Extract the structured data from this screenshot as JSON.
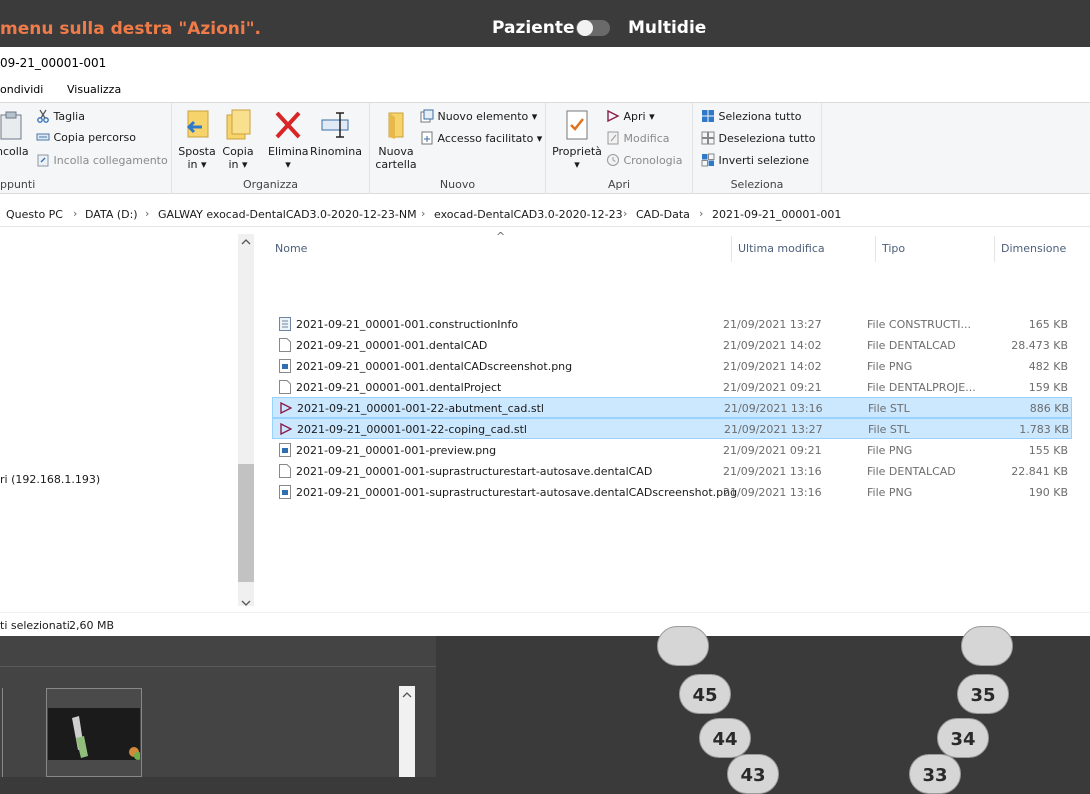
{
  "app_bar": {
    "hint": " menu sulla destra \"Azioni\".",
    "label_left": "Paziente",
    "label_right": "Multidie",
    "toggle_on": false
  },
  "window": {
    "title": "09-21_00001-001",
    "tabs": [
      "ondividi",
      "Visualizza"
    ]
  },
  "ribbon": {
    "clipboard": {
      "paste_label": "ncolla",
      "cut": "Taglia",
      "copy_path": "Copia percorso",
      "paste_link": "Incolla collegamento",
      "group": "ppunti"
    },
    "organize": {
      "move": "Sposta",
      "move_sub": "in ▾",
      "copy": "Copia",
      "copy_sub": "in ▾",
      "delete": "Elimina",
      "delete_sub": "▾",
      "rename": "Rinomina",
      "group": "Organizza"
    },
    "new": {
      "folder": "Nuova",
      "folder_sub": "cartella",
      "new_item": "Nuovo elemento ▾",
      "easy_access": "Accesso facilitato ▾",
      "group": "Nuovo"
    },
    "open": {
      "properties": "Proprietà",
      "properties_sub": "▾",
      "open": "Apri ▾",
      "edit": "Modifica",
      "history": "Cronologia",
      "group": "Apri"
    },
    "select": {
      "select_all": "Seleziona tutto",
      "deselect_all": "Deseleziona tutto",
      "invert": "Inverti selezione",
      "group": "Seleziona"
    }
  },
  "breadcrumb": [
    "Questo PC",
    "DATA (D:)",
    "GALWAY exocad-DentalCAD3.0-2020-12-23-NM",
    "exocad-DentalCAD3.0-2020-12-23",
    "CAD-Data",
    "2021-09-21_00001-001"
  ],
  "nav_pane": {
    "network_item": "ri (192.168.1.193)"
  },
  "columns": {
    "name": "Nome",
    "modified": "Ultima modifica",
    "type": "Tipo",
    "size": "Dimensione"
  },
  "files": [
    {
      "name": "2021-09-21_00001-001.constructionInfo",
      "modified": "21/09/2021 13:27",
      "type": "File CONSTRUCTI...",
      "size": "165 KB",
      "icon": "text-file-icon",
      "selected": false
    },
    {
      "name": "2021-09-21_00001-001.dentalCAD",
      "modified": "21/09/2021 14:02",
      "type": "File DENTALCAD",
      "size": "28.473 KB",
      "icon": "blank-file-icon",
      "selected": false
    },
    {
      "name": "2021-09-21_00001-001.dentalCADscreenshot.png",
      "modified": "21/09/2021 14:02",
      "type": "File PNG",
      "size": "482 KB",
      "icon": "image-file-icon",
      "selected": false
    },
    {
      "name": "2021-09-21_00001-001.dentalProject",
      "modified": "21/09/2021 09:21",
      "type": "File DENTALPROJE...",
      "size": "159 KB",
      "icon": "blank-file-icon",
      "selected": false
    },
    {
      "name": "2021-09-21_00001-001-22-abutment_cad.stl",
      "modified": "21/09/2021 13:16",
      "type": "File STL",
      "size": "886 KB",
      "icon": "stl-file-icon",
      "selected": true
    },
    {
      "name": "2021-09-21_00001-001-22-coping_cad.stl",
      "modified": "21/09/2021 13:27",
      "type": "File STL",
      "size": "1.783 KB",
      "icon": "stl-file-icon",
      "selected": true
    },
    {
      "name": "2021-09-21_00001-001-preview.png",
      "modified": "21/09/2021 09:21",
      "type": "File PNG",
      "size": "155 KB",
      "icon": "image-file-icon",
      "selected": false
    },
    {
      "name": "2021-09-21_00001-001-suprastructurestart-autosave.dentalCAD",
      "modified": "21/09/2021 13:16",
      "type": "File DENTALCAD",
      "size": "22.841 KB",
      "icon": "blank-file-icon",
      "selected": false
    },
    {
      "name": "2021-09-21_00001-001-suprastructurestart-autosave.dentalCADscreenshot.png",
      "modified": "21/09/2021 13:16",
      "type": "File PNG",
      "size": "190 KB",
      "icon": "image-file-icon",
      "selected": false
    }
  ],
  "status": {
    "selected": "ti selezionati",
    "size": "2,60 MB"
  },
  "teeth": [
    {
      "label": "45",
      "side": "right"
    },
    {
      "label": "44",
      "side": "right"
    },
    {
      "label": "43",
      "side": "right"
    },
    {
      "label": "35",
      "side": "left"
    },
    {
      "label": "34",
      "side": "left"
    },
    {
      "label": "33",
      "side": "left"
    }
  ],
  "colors": {
    "hint": "#ee7b48",
    "selection": "#cce8ff",
    "stl_icon": "#8b1d4a"
  }
}
